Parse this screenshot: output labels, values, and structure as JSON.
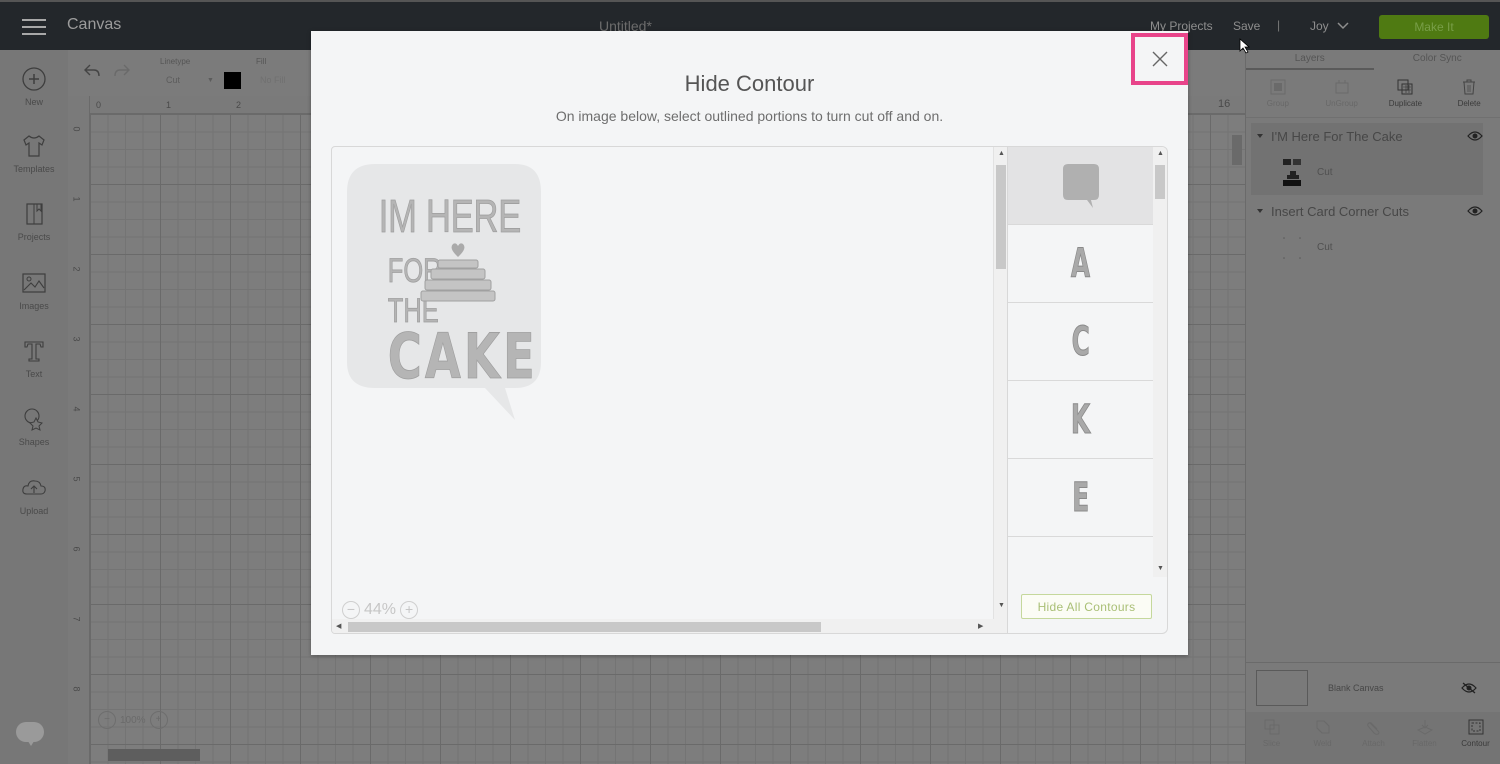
{
  "topbar": {
    "app_title": "Canvas",
    "doc_title": "Untitled*",
    "my_projects": "My Projects",
    "save": "Save",
    "separator": "|",
    "user": "Joy",
    "make_it": "Make It",
    "make_it_color": "#4f7a12"
  },
  "leftbar": {
    "items": [
      {
        "label": "New",
        "icon": "plus-circle-icon"
      },
      {
        "label": "Templates",
        "icon": "shirt-icon"
      },
      {
        "label": "Projects",
        "icon": "notebook-icon"
      },
      {
        "label": "Images",
        "icon": "image-icon"
      },
      {
        "label": "Text",
        "icon": "text-icon"
      },
      {
        "label": "Shapes",
        "icon": "shapes-icon"
      },
      {
        "label": "Upload",
        "icon": "cloud-upload-icon"
      }
    ]
  },
  "toolbar": {
    "linetype_label": "Linetype",
    "linetype_value": "Cut",
    "fill_label": "Fill",
    "fill_value": "No Fill",
    "swatch_color": "#000000"
  },
  "canvas": {
    "ruler_top": [
      "0",
      "1",
      "2",
      "16"
    ],
    "ruler_left": [
      "0",
      "1",
      "2",
      "3",
      "4",
      "5",
      "6",
      "7",
      "8"
    ],
    "zoom": "100%"
  },
  "right_panel": {
    "tabs": [
      {
        "label": "Layers",
        "active": true
      },
      {
        "label": "Color Sync",
        "active": false
      }
    ],
    "actions": [
      {
        "label": "Group",
        "enabled": false
      },
      {
        "label": "UnGroup",
        "enabled": false
      },
      {
        "label": "Duplicate",
        "enabled": true
      },
      {
        "label": "Delete",
        "enabled": true
      }
    ],
    "layers": [
      {
        "name": "I'M Here For The Cake",
        "sub": "Cut"
      },
      {
        "name": "Insert Card Corner Cuts",
        "sub": "Cut"
      }
    ],
    "blank_canvas": "Blank Canvas",
    "bottom_actions": [
      {
        "label": "Slice",
        "enabled": false
      },
      {
        "label": "Weld",
        "enabled": false
      },
      {
        "label": "Attach",
        "enabled": false
      },
      {
        "label": "Flatten",
        "enabled": false
      },
      {
        "label": "Contour",
        "enabled": true
      }
    ]
  },
  "modal": {
    "title": "Hide Contour",
    "subtitle": "On image below, select outlined portions to turn cut off and on.",
    "close_highlight_color": "#e8448a",
    "zoom": "44%",
    "zoom_out": "−",
    "zoom_in": "+",
    "design_text": [
      "IM HERE",
      "FOR",
      "THE",
      "CAKE"
    ],
    "contours": [
      {
        "glyph": "",
        "type": "speech-bubble",
        "selected": true
      },
      {
        "glyph": "A",
        "type": "letter",
        "selected": false
      },
      {
        "glyph": "C",
        "type": "letter",
        "selected": false
      },
      {
        "glyph": "K",
        "type": "letter",
        "selected": false
      },
      {
        "glyph": "E",
        "type": "letter",
        "selected": false
      },
      {
        "glyph": "",
        "type": "cake-tier",
        "selected": false
      }
    ],
    "hide_all_label": "Hide All Contours"
  }
}
